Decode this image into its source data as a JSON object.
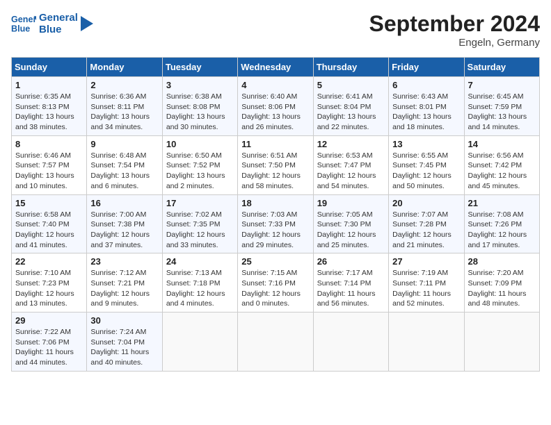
{
  "header": {
    "logo_line1": "General",
    "logo_line2": "Blue",
    "month": "September 2024",
    "location": "Engeln, Germany"
  },
  "weekdays": [
    "Sunday",
    "Monday",
    "Tuesday",
    "Wednesday",
    "Thursday",
    "Friday",
    "Saturday"
  ],
  "weeks": [
    [
      {
        "day": "1",
        "info": "Sunrise: 6:35 AM\nSunset: 8:13 PM\nDaylight: 13 hours\nand 38 minutes."
      },
      {
        "day": "2",
        "info": "Sunrise: 6:36 AM\nSunset: 8:11 PM\nDaylight: 13 hours\nand 34 minutes."
      },
      {
        "day": "3",
        "info": "Sunrise: 6:38 AM\nSunset: 8:08 PM\nDaylight: 13 hours\nand 30 minutes."
      },
      {
        "day": "4",
        "info": "Sunrise: 6:40 AM\nSunset: 8:06 PM\nDaylight: 13 hours\nand 26 minutes."
      },
      {
        "day": "5",
        "info": "Sunrise: 6:41 AM\nSunset: 8:04 PM\nDaylight: 13 hours\nand 22 minutes."
      },
      {
        "day": "6",
        "info": "Sunrise: 6:43 AM\nSunset: 8:01 PM\nDaylight: 13 hours\nand 18 minutes."
      },
      {
        "day": "7",
        "info": "Sunrise: 6:45 AM\nSunset: 7:59 PM\nDaylight: 13 hours\nand 14 minutes."
      }
    ],
    [
      {
        "day": "8",
        "info": "Sunrise: 6:46 AM\nSunset: 7:57 PM\nDaylight: 13 hours\nand 10 minutes."
      },
      {
        "day": "9",
        "info": "Sunrise: 6:48 AM\nSunset: 7:54 PM\nDaylight: 13 hours\nand 6 minutes."
      },
      {
        "day": "10",
        "info": "Sunrise: 6:50 AM\nSunset: 7:52 PM\nDaylight: 13 hours\nand 2 minutes."
      },
      {
        "day": "11",
        "info": "Sunrise: 6:51 AM\nSunset: 7:50 PM\nDaylight: 12 hours\nand 58 minutes."
      },
      {
        "day": "12",
        "info": "Sunrise: 6:53 AM\nSunset: 7:47 PM\nDaylight: 12 hours\nand 54 minutes."
      },
      {
        "day": "13",
        "info": "Sunrise: 6:55 AM\nSunset: 7:45 PM\nDaylight: 12 hours\nand 50 minutes."
      },
      {
        "day": "14",
        "info": "Sunrise: 6:56 AM\nSunset: 7:42 PM\nDaylight: 12 hours\nand 45 minutes."
      }
    ],
    [
      {
        "day": "15",
        "info": "Sunrise: 6:58 AM\nSunset: 7:40 PM\nDaylight: 12 hours\nand 41 minutes."
      },
      {
        "day": "16",
        "info": "Sunrise: 7:00 AM\nSunset: 7:38 PM\nDaylight: 12 hours\nand 37 minutes."
      },
      {
        "day": "17",
        "info": "Sunrise: 7:02 AM\nSunset: 7:35 PM\nDaylight: 12 hours\nand 33 minutes."
      },
      {
        "day": "18",
        "info": "Sunrise: 7:03 AM\nSunset: 7:33 PM\nDaylight: 12 hours\nand 29 minutes."
      },
      {
        "day": "19",
        "info": "Sunrise: 7:05 AM\nSunset: 7:30 PM\nDaylight: 12 hours\nand 25 minutes."
      },
      {
        "day": "20",
        "info": "Sunrise: 7:07 AM\nSunset: 7:28 PM\nDaylight: 12 hours\nand 21 minutes."
      },
      {
        "day": "21",
        "info": "Sunrise: 7:08 AM\nSunset: 7:26 PM\nDaylight: 12 hours\nand 17 minutes."
      }
    ],
    [
      {
        "day": "22",
        "info": "Sunrise: 7:10 AM\nSunset: 7:23 PM\nDaylight: 12 hours\nand 13 minutes."
      },
      {
        "day": "23",
        "info": "Sunrise: 7:12 AM\nSunset: 7:21 PM\nDaylight: 12 hours\nand 9 minutes."
      },
      {
        "day": "24",
        "info": "Sunrise: 7:13 AM\nSunset: 7:18 PM\nDaylight: 12 hours\nand 4 minutes."
      },
      {
        "day": "25",
        "info": "Sunrise: 7:15 AM\nSunset: 7:16 PM\nDaylight: 12 hours\nand 0 minutes."
      },
      {
        "day": "26",
        "info": "Sunrise: 7:17 AM\nSunset: 7:14 PM\nDaylight: 11 hours\nand 56 minutes."
      },
      {
        "day": "27",
        "info": "Sunrise: 7:19 AM\nSunset: 7:11 PM\nDaylight: 11 hours\nand 52 minutes."
      },
      {
        "day": "28",
        "info": "Sunrise: 7:20 AM\nSunset: 7:09 PM\nDaylight: 11 hours\nand 48 minutes."
      }
    ],
    [
      {
        "day": "29",
        "info": "Sunrise: 7:22 AM\nSunset: 7:06 PM\nDaylight: 11 hours\nand 44 minutes."
      },
      {
        "day": "30",
        "info": "Sunrise: 7:24 AM\nSunset: 7:04 PM\nDaylight: 11 hours\nand 40 minutes."
      },
      {
        "day": "",
        "info": ""
      },
      {
        "day": "",
        "info": ""
      },
      {
        "day": "",
        "info": ""
      },
      {
        "day": "",
        "info": ""
      },
      {
        "day": "",
        "info": ""
      }
    ]
  ]
}
